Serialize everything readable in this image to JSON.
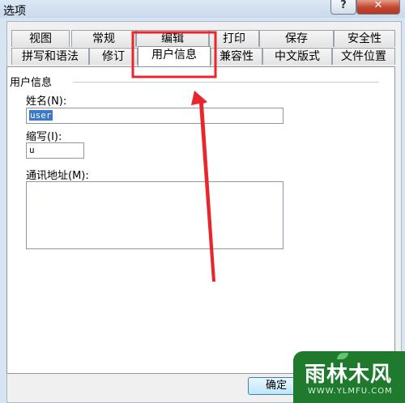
{
  "window": {
    "title": "选项",
    "help_label": "?",
    "close_label": "✕"
  },
  "tabs_row_top": [
    "视图",
    "常规",
    "编辑",
    "打印",
    "保存",
    "安全性"
  ],
  "tabs_row_bottom": [
    "拼写和语法",
    "修订",
    "用户信息",
    "兼容性",
    "中文版式",
    "文件位置"
  ],
  "active_tab": "用户信息",
  "panel": {
    "group_title": "用户信息",
    "name_label": "姓名(N):",
    "name_value": "user",
    "initials_label": "缩写(I):",
    "initials_value": "u",
    "address_label": "通讯地址(M):",
    "address_value": ""
  },
  "footer": {
    "ok_label": "确定"
  },
  "annotation": {
    "highlight_color": "#e8262b"
  },
  "watermark": {
    "main": "雨林木风",
    "sub": "WWW.YLMFU.COM"
  }
}
